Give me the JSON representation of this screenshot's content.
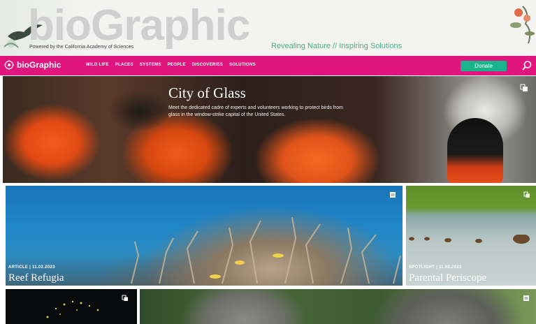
{
  "banner": {
    "wordmark": "bioGraphic",
    "powered_by": "Powered by the California Academy of Sciences",
    "tagline": "Revealing Nature // Inspiring Solutions"
  },
  "nav": {
    "logo_text": "bioGraphic",
    "items": [
      "WILD LIFE",
      "PLACES",
      "SYSTEMS",
      "PEOPLE",
      "DISCOVERIES",
      "SOLUTIONS"
    ],
    "donate_label": "Donate"
  },
  "hero": {
    "title": "City of Glass",
    "description": "Meet the dedicated cadre of experts and volunteers working to protect birds from glass in the window-strike capital of the United States."
  },
  "cards": [
    {
      "label": "ARTICLE | 11.02.2023",
      "title": "Reef Refugia"
    },
    {
      "label": "SPOTLIGHT | 11.02.2023",
      "title": "Parental Periscope"
    }
  ],
  "colors": {
    "nav_bg": "#e0157d",
    "donate_bg": "#18b58c",
    "tagline": "#4caf84"
  }
}
